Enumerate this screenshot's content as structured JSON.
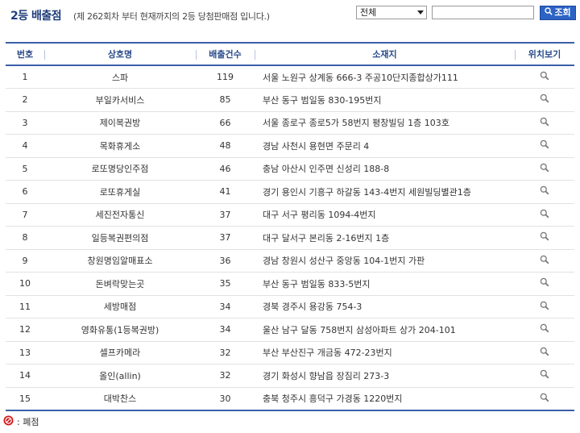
{
  "header": {
    "title": "2등 배출점",
    "subtitle": "(제 262회차 부터 현재까지의 2등 당첨판매점 입니다.)"
  },
  "search": {
    "select_value": "전체",
    "input_value": "",
    "button_label": "조회",
    "button_icon": "search-icon"
  },
  "table": {
    "headers": [
      "번호",
      "상호명",
      "배출건수",
      "소재지",
      "위치보기"
    ],
    "rows": [
      {
        "no": "1",
        "name": "스파",
        "count": "119",
        "address": "서울 노원구 상계동 666-3 주공10단지종합상가111"
      },
      {
        "no": "2",
        "name": "부일카서비스",
        "count": "85",
        "address": "부산 동구 범일동 830-195번지"
      },
      {
        "no": "3",
        "name": "제이복권방",
        "count": "66",
        "address": "서울 종로구 종로5가 58번지 평창빌딩 1층 103호"
      },
      {
        "no": "4",
        "name": "목화휴게소",
        "count": "48",
        "address": "경남 사천시 용현면 주문리 4"
      },
      {
        "no": "5",
        "name": "로또명당인주점",
        "count": "46",
        "address": "충남 아산시 인주면 신성리 188-8"
      },
      {
        "no": "6",
        "name": "로또휴게실",
        "count": "41",
        "address": "경기 용인시 기흥구 하갈동 143-4번지 세원빌딩별관1층"
      },
      {
        "no": "7",
        "name": "세진전자통신",
        "count": "37",
        "address": "대구 서구 평리동 1094-4번지"
      },
      {
        "no": "8",
        "name": "일등복권편의점",
        "count": "37",
        "address": "대구 달서구 본리동 2-16번지 1층"
      },
      {
        "no": "9",
        "name": "창원명임알매표소",
        "count": "36",
        "address": "경남 창원시 성산구 중앙동 104-1번지 가판"
      },
      {
        "no": "10",
        "name": "돈벼락맞는곳",
        "count": "35",
        "address": "부산 동구 범일동 833-5번지"
      },
      {
        "no": "11",
        "name": "세방매점",
        "count": "34",
        "address": "경북 경주시 용강동 754-3"
      },
      {
        "no": "12",
        "name": "영화유통(1등복권방)",
        "count": "34",
        "address": "울산 남구 달동 758번지 삼성아파트 상가 204-101"
      },
      {
        "no": "13",
        "name": "셀프카메라",
        "count": "32",
        "address": "부산 부산진구 개금동 472-23번지"
      },
      {
        "no": "14",
        "name": "올인(allin)",
        "count": "32",
        "address": "경기 화성시 향남읍 장짐리 273-3"
      },
      {
        "no": "15",
        "name": "대박찬스",
        "count": "30",
        "address": "충북 청주시 흥덕구 가경동 1220번지"
      }
    ],
    "location_icon": "magnifier-icon"
  },
  "legend": {
    "label": ": 폐점",
    "icon": "closed-icon"
  },
  "colors": {
    "accent": "#3b5fa8",
    "title": "#1f3d7a",
    "button": "#2d63c4",
    "closed": "#d01818"
  }
}
